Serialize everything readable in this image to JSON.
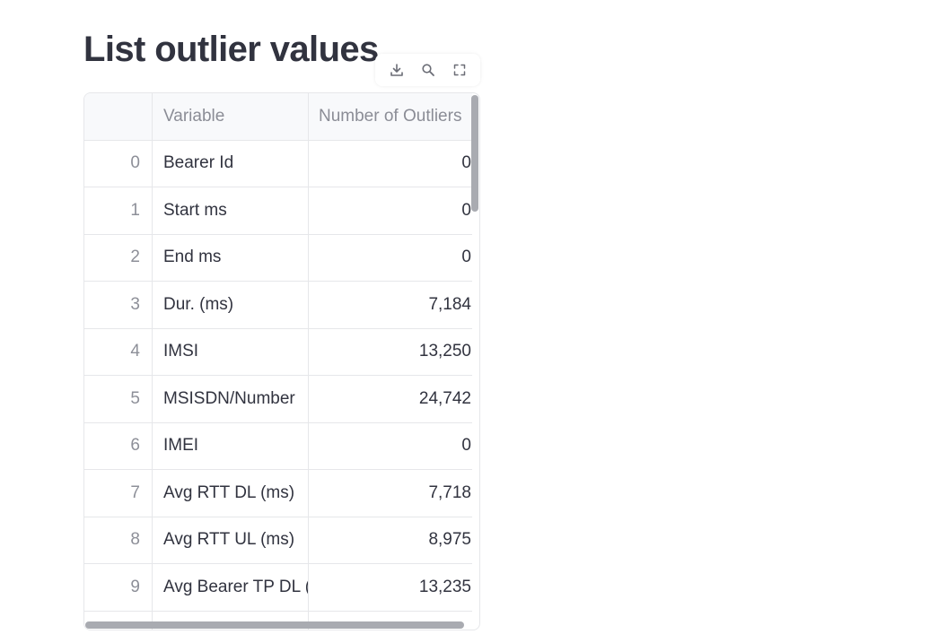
{
  "page": {
    "title": "List outlier values"
  },
  "toolbar": {
    "download_icon": "download-icon",
    "search_icon": "search-icon",
    "fullscreen_icon": "fullscreen-icon"
  },
  "table": {
    "columns": {
      "index": "",
      "variable": "Variable",
      "outliers": "Number of Outliers"
    },
    "rows": [
      {
        "index": "0",
        "variable": "Bearer Id",
        "outliers": "0"
      },
      {
        "index": "1",
        "variable": "Start ms",
        "outliers": "0"
      },
      {
        "index": "2",
        "variable": "End ms",
        "outliers": "0"
      },
      {
        "index": "3",
        "variable": "Dur. (ms)",
        "outliers": "7,184"
      },
      {
        "index": "4",
        "variable": "IMSI",
        "outliers": "13,250"
      },
      {
        "index": "5",
        "variable": "MSISDN/Number",
        "outliers": "24,742"
      },
      {
        "index": "6",
        "variable": "IMEI",
        "outliers": "0"
      },
      {
        "index": "7",
        "variable": "Avg RTT DL (ms)",
        "outliers": "7,718"
      },
      {
        "index": "8",
        "variable": "Avg RTT UL (ms)",
        "outliers": "8,975"
      },
      {
        "index": "9",
        "variable": "Avg Bearer TP DL (kbps)",
        "outliers": "13,235"
      }
    ]
  }
}
